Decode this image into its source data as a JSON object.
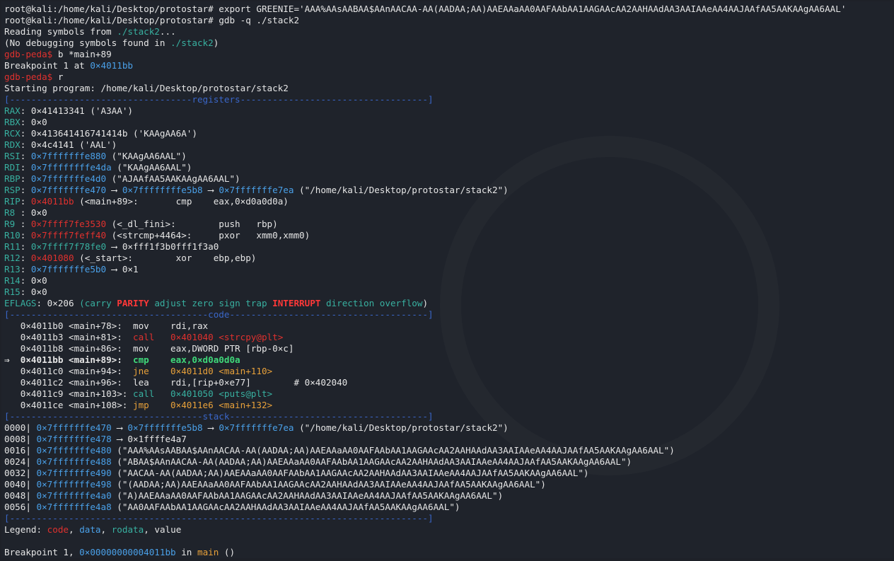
{
  "prompt": {
    "root": "root@kali:/home/kali/Desktop/protostar# ",
    "gdb": "gdb-peda$ "
  },
  "cmds": {
    "export": "export GREENIE='AAA%AAsAABAA$AAnAACAA-AA(AADAA;AA)AAEAAaAA0AAFAAbAA1AAGAAcAA2AAHAAdAA3AAIAAeAA4AAJAAfAA5AAKAAgAA6AAL'",
    "gdb": "gdb -q ./stack2",
    "break": "b *main+89",
    "run": "r"
  },
  "init": {
    "reading_a": "Reading symbols from ",
    "reading_b": "./stack2",
    "reading_c": "...",
    "nodebug_a": "(No debugging symbols found in ",
    "nodebug_b": "./stack2",
    "nodebug_c": ")",
    "bp_a": "Breakpoint 1 at ",
    "bp_b": "0×4011bb",
    "starting": "Starting program: /home/kali/Desktop/protostar/stack2"
  },
  "separators": {
    "registers": "[----------------------------------registers-----------------------------------]",
    "code": "[-------------------------------------code-------------------------------------]",
    "stack": "[------------------------------------stack-------------------------------------]",
    "end": "[------------------------------------------------------------------------------]"
  },
  "registers": [
    {
      "name": "RAX",
      "parts": [
        {
          "c": "w",
          "t": "0×41413341 ('A3AA')"
        }
      ]
    },
    {
      "name": "RBX",
      "parts": [
        {
          "c": "w",
          "t": "0×0"
        }
      ]
    },
    {
      "name": "RCX",
      "parts": [
        {
          "c": "w",
          "t": "0×413641416741414b ('KAAgAA6A')"
        }
      ]
    },
    {
      "name": "RDX",
      "parts": [
        {
          "c": "w",
          "t": "0×4c4141 ('AAL')"
        }
      ]
    },
    {
      "name": "RSI",
      "parts": [
        {
          "c": "b",
          "t": "0×7fffffffe880"
        },
        {
          "c": "w",
          "t": " (\"KAAgAA6AAL\")"
        }
      ]
    },
    {
      "name": "RDI",
      "parts": [
        {
          "c": "b",
          "t": "0×7ffffffffe4da"
        },
        {
          "c": "w",
          "t": " (\"KAAgAA6AAL\")"
        }
      ]
    },
    {
      "name": "RBP",
      "parts": [
        {
          "c": "b",
          "t": "0×7fffffffe4d0"
        },
        {
          "c": "w",
          "t": " (\"AJAAfAA5AAKAAgAA6AAL\")"
        }
      ]
    },
    {
      "name": "RSP",
      "parts": [
        {
          "c": "b",
          "t": "0×7fffffffe470"
        },
        {
          "c": "w",
          "t": " ⟶ "
        },
        {
          "c": "b",
          "t": "0×7ffffffffe5b8"
        },
        {
          "c": "w",
          "t": " ⟶ "
        },
        {
          "c": "b",
          "t": "0×7fffffffe7ea"
        },
        {
          "c": "w",
          "t": " (\"/home/kali/Desktop/protostar/stack2\")"
        }
      ]
    },
    {
      "name": "RIP",
      "parts": [
        {
          "c": "r",
          "t": "0×4011bb"
        },
        {
          "c": "w",
          "t": " (<main+89>:       cmp    eax,0×d0a0d0a)"
        }
      ]
    },
    {
      "name": "R8 ",
      "parts": [
        {
          "c": "w",
          "t": "0×0"
        }
      ]
    },
    {
      "name": "R9 ",
      "parts": [
        {
          "c": "r",
          "t": "0×7ffff7fe3530"
        },
        {
          "c": "w",
          "t": " (<_dl_fini>:        push   rbp)"
        }
      ]
    },
    {
      "name": "R10",
      "parts": [
        {
          "c": "r",
          "t": "0×7ffff7feff40"
        },
        {
          "c": "w",
          "t": " (<strcmp+4464>:     pxor   xmm0,xmm0)"
        }
      ]
    },
    {
      "name": "R11",
      "parts": [
        {
          "c": "g",
          "t": "0×7ffff7f78fe0"
        },
        {
          "c": "w",
          "t": " ⟶ 0×fff1f3b0fff1f3a0"
        }
      ]
    },
    {
      "name": "R12",
      "parts": [
        {
          "c": "r",
          "t": "0×401080"
        },
        {
          "c": "w",
          "t": " (<_start>:        xor    ebp,ebp)"
        }
      ]
    },
    {
      "name": "R13",
      "parts": [
        {
          "c": "b",
          "t": "0×7fffffffe5b0"
        },
        {
          "c": "w",
          "t": " ⟶ 0×1"
        }
      ]
    },
    {
      "name": "R14",
      "parts": [
        {
          "c": "w",
          "t": "0×0"
        }
      ]
    },
    {
      "name": "R15",
      "parts": [
        {
          "c": "w",
          "t": "0×0"
        }
      ]
    },
    {
      "name": "EFLAGS",
      "parts": [
        {
          "c": "w",
          "t": "0×206 "
        },
        {
          "c": "g",
          "t": "(carry "
        },
        {
          "c": "fr",
          "t": "PARITY"
        },
        {
          "c": "g",
          "t": " adjust zero sign trap "
        },
        {
          "c": "fr",
          "t": "INTERRUPT"
        },
        {
          "c": "g",
          "t": " direction overflow"
        },
        {
          "c": "w",
          "t": ")"
        }
      ]
    }
  ],
  "code": [
    {
      "arrow": "   ",
      "addr": "0×4011b0 <main+78>:  ",
      "parts": [
        {
          "c": "w",
          "t": "mov    rdi,rax"
        }
      ]
    },
    {
      "arrow": "   ",
      "addr": "0×4011b3 <main+81>:  ",
      "parts": [
        {
          "c": "r",
          "t": "call   0×401040 <strcpy@plt>"
        }
      ]
    },
    {
      "arrow": "   ",
      "addr": "0×4011b8 <main+86>:  ",
      "parts": [
        {
          "c": "w",
          "t": "mov    eax,DWORD PTR [rbp-0×c]"
        }
      ]
    },
    {
      "arrow": "⇒  ",
      "addr": "0×4011bb <main+89>:  ",
      "parts": [
        {
          "c": "gb",
          "t": "cmp    eax,0×d0a0d0a"
        }
      ]
    },
    {
      "arrow": "   ",
      "addr": "0×4011c0 <main+94>:  ",
      "parts": [
        {
          "c": "y",
          "t": "jne    0×4011d0 <main+110>"
        }
      ]
    },
    {
      "arrow": "   ",
      "addr": "0×4011c2 <main+96>:  ",
      "parts": [
        {
          "c": "w",
          "t": "lea    rdi,[rip+0×e77]        # 0×402040"
        }
      ]
    },
    {
      "arrow": "   ",
      "addr": "0×4011c9 <main+103>: ",
      "parts": [
        {
          "c": "g",
          "t": "call   0×401050 <puts@plt>"
        }
      ]
    },
    {
      "arrow": "   ",
      "addr": "0×4011ce <main+108>: ",
      "parts": [
        {
          "c": "y",
          "t": "jmp    0×4011e6 <main+132>"
        }
      ]
    }
  ],
  "stack": [
    {
      "off": "0000",
      "addr": "0×7fffffffe470",
      "parts": [
        {
          "c": "w",
          "t": " ⟶ "
        },
        {
          "c": "b",
          "t": "0×7fffffffe5b8"
        },
        {
          "c": "w",
          "t": " ⟶ "
        },
        {
          "c": "b",
          "t": "0×7fffffffe7ea"
        },
        {
          "c": "w",
          "t": " (\"/home/kali/Desktop/protostar/stack2\")"
        }
      ]
    },
    {
      "off": "0008",
      "addr": "0×7fffffffe478",
      "parts": [
        {
          "c": "w",
          "t": " ⟶ 0×1ffffe4a7"
        }
      ]
    },
    {
      "off": "0016",
      "addr": "0×7fffffffe480",
      "parts": [
        {
          "c": "w",
          "t": " (\"AAA%AAsAABAA$AAnAACAA-AA(AADAA;AA)AAEAAaAA0AAFAAbAA1AAGAAcAA2AAHAAdAA3AAIAAeAA4AAJAAfAA5AAKAAgAA6AAL\")"
        }
      ]
    },
    {
      "off": "0024",
      "addr": "0×7fffffffe488",
      "parts": [
        {
          "c": "w",
          "t": " (\"ABAA$AAnAACAA-AA(AADAA;AA)AAEAAaAA0AAFAAbAA1AAGAAcAA2AAHAAdAA3AAIAAeAA4AAJAAfAA5AAKAAgAA6AAL\")"
        }
      ]
    },
    {
      "off": "0032",
      "addr": "0×7fffffffe490",
      "parts": [
        {
          "c": "w",
          "t": " (\"AACAA-AA(AADAA;AA)AAEAAaAA0AAFAAbAA1AAGAAcAA2AAHAAdAA3AAIAAeAA4AAJAAfAA5AAKAAgAA6AAL\")"
        }
      ]
    },
    {
      "off": "0040",
      "addr": "0×7fffffffe498",
      "parts": [
        {
          "c": "w",
          "t": " (\"(AADAA;AA)AAEAAaAA0AAFAAbAA1AAGAAcAA2AAHAAdAA3AAIAAeAA4AAJAAfAA5AAKAAgAA6AAL\")"
        }
      ]
    },
    {
      "off": "0048",
      "addr": "0×7fffffffe4a0",
      "parts": [
        {
          "c": "w",
          "t": " (\"A)AAEAAaAA0AAFAAbAA1AAGAAcAA2AAHAAdAA3AAIAAeAA4AAJAAfAA5AAKAAgAA6AAL\")"
        }
      ]
    },
    {
      "off": "0056",
      "addr": "0×7fffffffe4a8",
      "parts": [
        {
          "c": "w",
          "t": " (\"AA0AAFAAbAA1AAGAAcAA2AAHAAdAA3AAIAAeAA4AAJAAfAA5AAKAAgAA6AAL\")"
        }
      ]
    }
  ],
  "legend": {
    "label": "Legend: ",
    "code": "code",
    "c1": ", ",
    "data": "data",
    "c2": ", ",
    "rodata": "rodata",
    "c3": ", ",
    "value": "value"
  },
  "footer": {
    "a": "Breakpoint 1, ",
    "b": "0×00000000004011bb",
    "c": " in ",
    "d": "main",
    "e": " ()"
  },
  "colors": {
    "background": "#1f232b",
    "text": "#e6e6e6",
    "blue": "#4aa0e8",
    "red": "#e0312e",
    "green": "#38b0a0",
    "yellow": "#e8a13a",
    "separator": "#3a66c8"
  }
}
